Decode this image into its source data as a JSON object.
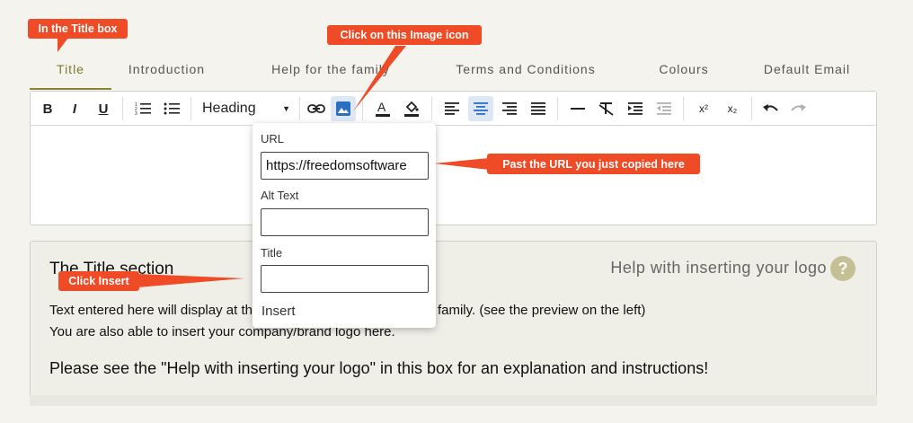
{
  "tabs": [
    {
      "label": "Title"
    },
    {
      "label": "Introduction"
    },
    {
      "label": "Help for the family"
    },
    {
      "label": "Terms and Conditions"
    },
    {
      "label": "Colours"
    },
    {
      "label": "Default Email"
    }
  ],
  "toolbar": {
    "heading_label": "Heading",
    "superscript": "x²",
    "subscript": "x₂"
  },
  "popup": {
    "url_label": "URL",
    "url_value": "https://freedomsoftware",
    "alt_label": "Alt Text",
    "title_label": "Title",
    "insert_label": "Insert"
  },
  "help": {
    "title": "The Title section",
    "link": "Help with inserting your logo",
    "q": "?",
    "p1": "Text entered here will display at the top of the page shown to the family. (see the preview on the left)",
    "p2": "You are also able to insert your company/brand logo here.",
    "p3": "Please see the \"Help with inserting your logo\" in this box for an explanation and instructions!"
  },
  "callouts": {
    "title_box": "In the Title box",
    "image_icon": "Click on this Image icon",
    "paste_url": "Past the URL you just copied here",
    "click_insert": "Click Insert"
  },
  "colors": {
    "callout": "#ee4b26",
    "active_tab": "#8a8330",
    "active_button": "#dee8f5"
  }
}
